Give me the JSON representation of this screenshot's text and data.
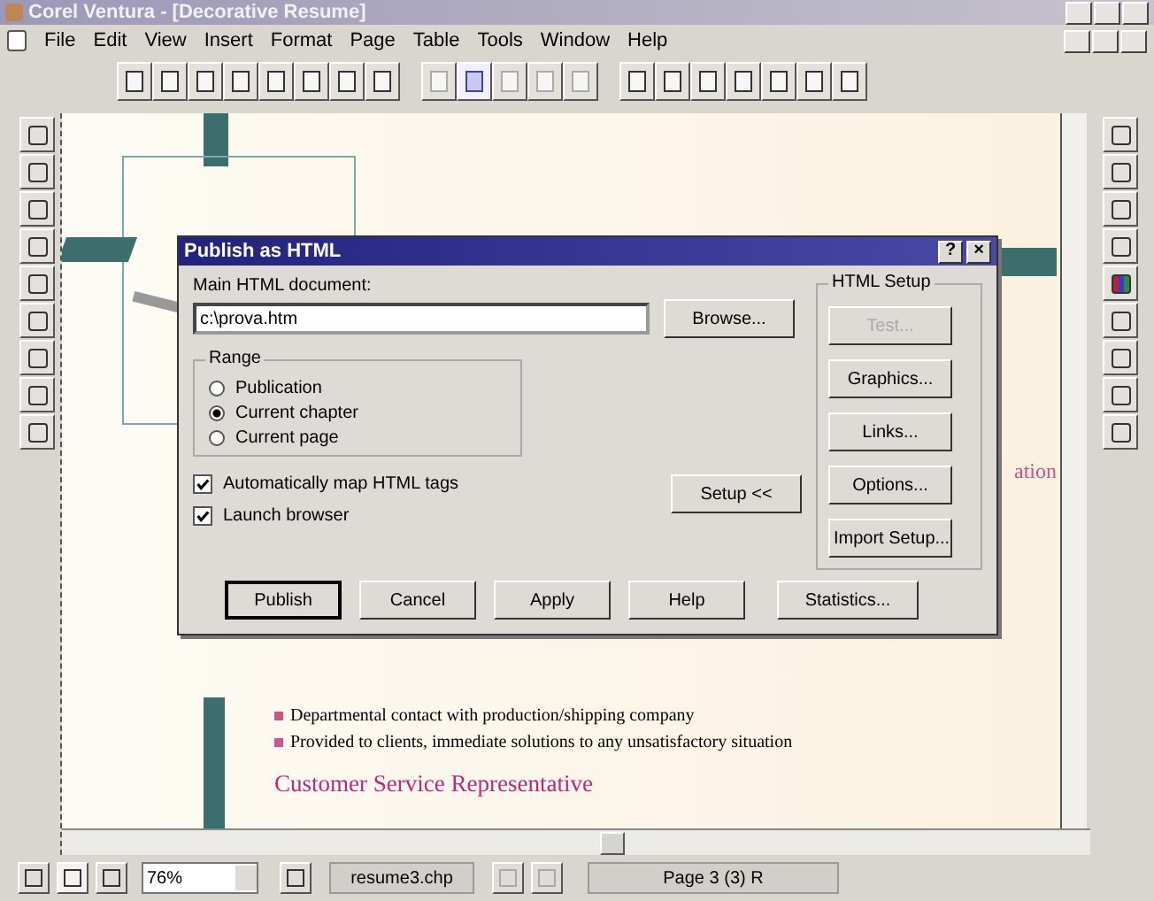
{
  "window": {
    "title": "Corel Ventura - [Decorative Resume]"
  },
  "menu": [
    "File",
    "Edit",
    "View",
    "Insert",
    "Format",
    "Page",
    "Table",
    "Tools",
    "Window",
    "Help"
  ],
  "document": {
    "side_text": "ation",
    "bullets": [
      "Departmental contact with production/shipping company",
      "Provided to clients, immediate solutions to any unsatisfactory situation"
    ],
    "heading": "Customer Service Representative"
  },
  "dialog": {
    "title": "Publish as HTML",
    "help_button": "?",
    "close_button": "×",
    "main_label": "Main HTML document:",
    "main_value": "c:\\prova.htm",
    "browse": "Browse...",
    "range": {
      "label": "Range",
      "options": [
        {
          "label": "Publication",
          "selected": false
        },
        {
          "label": "Current chapter",
          "selected": true
        },
        {
          "label": "Current page",
          "selected": false
        }
      ]
    },
    "checks": [
      {
        "label": "Automatically map HTML tags",
        "checked": true
      },
      {
        "label": "Launch browser",
        "checked": true
      }
    ],
    "setup_button": "Setup <<",
    "html_setup": {
      "label": "HTML Setup",
      "buttons": [
        {
          "label": "Test...",
          "disabled": true
        },
        {
          "label": "Graphics...",
          "disabled": false
        },
        {
          "label": "Links...",
          "disabled": false
        },
        {
          "label": "Options...",
          "disabled": false
        },
        {
          "label": "Import Setup...",
          "disabled": false
        }
      ]
    },
    "buttons": [
      "Publish",
      "Cancel",
      "Apply",
      "Help",
      "Statistics..."
    ]
  },
  "status_bar": {
    "zoom": "76%",
    "file": "resume3.chp",
    "page": "Page 3 (3)  R"
  }
}
